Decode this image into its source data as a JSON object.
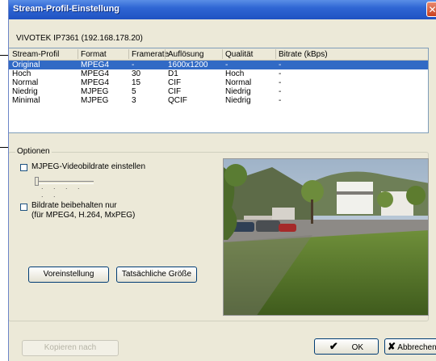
{
  "window": {
    "title": "Stream-Profil-Einstellung",
    "close_glyph": "✕"
  },
  "device": "VIVOTEK IP7361 (192.168.178.20)",
  "table": {
    "columns": [
      "Stream-Profil",
      "Format",
      "Framerate",
      "Auflösung",
      "Qualität",
      "Bitrate (kBps)"
    ],
    "rows": [
      [
        "Original",
        "MPEG4",
        "-",
        "1600x1200",
        "-",
        "-"
      ],
      [
        "Hoch",
        "MPEG4",
        "30",
        "D1",
        "Hoch",
        "-"
      ],
      [
        "Normal",
        "MPEG4",
        "15",
        "CIF",
        "Normal",
        "-"
      ],
      [
        "Niedrig",
        "MJPEG",
        "5",
        "CIF",
        "Niedrig",
        "-"
      ],
      [
        "Minimal",
        "MJPEG",
        "3",
        "QCIF",
        "Niedrig",
        "-"
      ]
    ],
    "selected_row": 0
  },
  "options": {
    "group_label": "Optionen",
    "mjpeg_label": "MJPEG-Videobildrate einstellen",
    "slider_dots": ". . . . . .",
    "bitrate_label_1": "Bildrate beibehalten nur",
    "bitrate_label_2": "(für MPEG4, H.264, MxPEG)",
    "defaults_button": "Voreinstellung",
    "actual_size_button": "Tatsächliche Größe"
  },
  "footer": {
    "copy_button": "Kopieren nach",
    "ok_button": "OK",
    "ok_glyph": "✔",
    "cancel_button": "Abbrechen",
    "cancel_glyph": "✘"
  },
  "colors": {
    "selection": "#316ac5",
    "titlebar": "#2f66d4",
    "dialog": "#ece9d8"
  }
}
